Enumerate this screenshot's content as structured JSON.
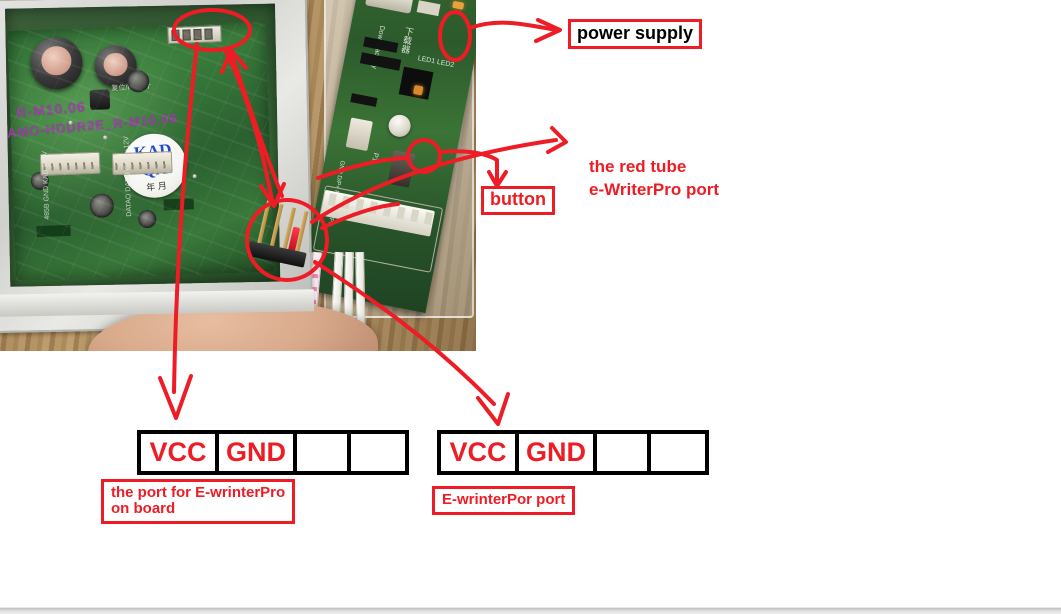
{
  "document": {
    "type": "annotated-photo",
    "description": "Annotated photograph of a wall-panel controller PCB and an e-WriterPro download board with red hand-drawn markup"
  },
  "colors": {
    "annotation_red": "#ee1c24",
    "table_border": "#000000",
    "pin_label": "#ee1c24",
    "page_background": "#ffffff"
  },
  "photo": {
    "name": "pcb-photograph",
    "alt": "Opened wall panel showing green control PCB on left and transparent-cased download key board on right, resting on a wooden desk with a finger at the bottom",
    "silkscreen": {
      "reset_text": "复位/RESET",
      "stamp_line1": "R-M10.06",
      "stamp_line2": "AMO-HDDR9E_R-M10.06",
      "qa_sticker_line1": "KAD",
      "qa_sticker_line2": "QA",
      "qa_sticker_line3": "年 月",
      "pin_labels_left": "485B GND KAD +12V",
      "pin_labels_right": "DATAO DATAI GND +12V"
    },
    "board2_silkscreen": {
      "download_key": "Download key",
      "p1": "P1",
      "leds": "LED1 LED2",
      "port_pins": "GND D/P+ P2 S P- D/PD"
    }
  },
  "annotations": [
    {
      "id": "power-supply",
      "kind": "boxed-label",
      "text": "power supply",
      "text_color": "#000000",
      "border_color": "#ee1c24",
      "points_to": "orange power connector on download board"
    },
    {
      "id": "button",
      "kind": "boxed-label",
      "text": "button",
      "text_color": "#ee1c24",
      "border_color": "#ee1c24",
      "points_to": "round white push button on download board"
    },
    {
      "id": "red-tube-port",
      "kind": "plain-label",
      "line1": "the red tube",
      "line2": "e-WriterPro port",
      "text_color": "#ee1c24",
      "points_to": "red-sleeved pin on the pin header"
    },
    {
      "id": "port-for-ewriterpro-on-board",
      "kind": "boxed-label",
      "line1": "the port for E-wrinterPro",
      "line2": "on board",
      "text_color": "#ee1c24",
      "border_color": "#ee1c24"
    },
    {
      "id": "ewriterpro-port",
      "kind": "boxed-label",
      "text": "E-wrinterPor port",
      "text_color": "#ee1c24",
      "border_color": "#ee1c24"
    }
  ],
  "circles": [
    {
      "id": "circle-board-header",
      "target": "4-pin header on main PCB"
    },
    {
      "id": "circle-power-supply",
      "target": "power supply connector"
    },
    {
      "id": "circle-button",
      "target": "push button"
    },
    {
      "id": "circle-pin-header",
      "target": "pin header with red tube"
    }
  ],
  "pin_tables": [
    {
      "id": "left-pin-table",
      "caption_line1": "the port for E-wrinterPro",
      "caption_line2": "on board",
      "cells": [
        {
          "label": "VCC",
          "width": "wide"
        },
        {
          "label": "GND",
          "width": "wide"
        },
        {
          "label": "",
          "width": "narrow"
        },
        {
          "label": "",
          "width": "narrow"
        }
      ]
    },
    {
      "id": "right-pin-table",
      "caption_line1": "E-wrinterPor port",
      "caption_line2": "",
      "cells": [
        {
          "label": "VCC",
          "width": "wide"
        },
        {
          "label": "GND",
          "width": "wide"
        },
        {
          "label": "",
          "width": "narrow"
        },
        {
          "label": "",
          "width": "narrow"
        }
      ]
    }
  ]
}
